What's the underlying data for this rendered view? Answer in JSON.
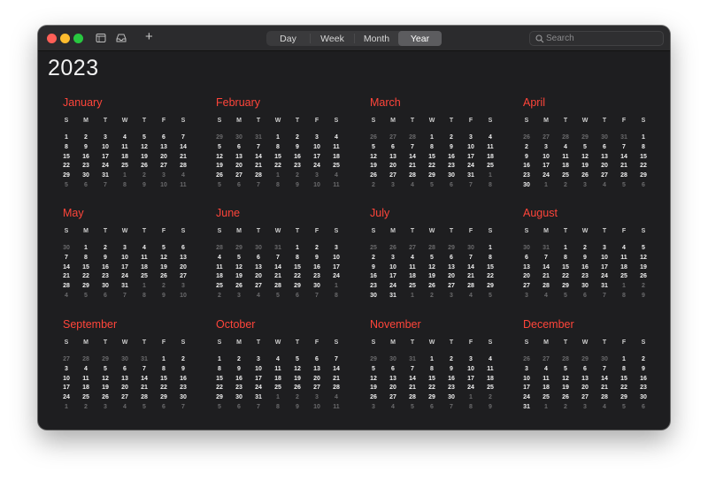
{
  "toolbar": {
    "add_label": "+",
    "views": [
      {
        "label": "Day",
        "active": false
      },
      {
        "label": "Week",
        "active": false
      },
      {
        "label": "Month",
        "active": false
      },
      {
        "label": "Year",
        "active": true
      }
    ],
    "search_placeholder": "Search"
  },
  "year": "2023",
  "weekday_labels": [
    "S",
    "M",
    "T",
    "W",
    "T",
    "F",
    "S"
  ],
  "colors": {
    "accent": "#ff453a",
    "background": "#1e1e20"
  },
  "months": [
    {
      "name": "January",
      "weeks": [
        [
          1,
          2,
          3,
          4,
          5,
          6,
          7
        ],
        [
          8,
          9,
          10,
          11,
          12,
          13,
          14
        ],
        [
          15,
          16,
          17,
          18,
          19,
          20,
          21
        ],
        [
          22,
          23,
          24,
          25,
          26,
          27,
          28
        ],
        [
          29,
          30,
          31,
          1,
          2,
          3,
          4
        ],
        [
          5,
          6,
          7,
          8,
          9,
          10,
          11
        ]
      ],
      "lead": 0,
      "days": 31
    },
    {
      "name": "February",
      "weeks": [
        [
          29,
          30,
          31,
          1,
          2,
          3,
          4
        ],
        [
          5,
          6,
          7,
          8,
          9,
          10,
          11
        ],
        [
          12,
          13,
          14,
          15,
          16,
          17,
          18
        ],
        [
          19,
          20,
          21,
          22,
          23,
          24,
          25
        ],
        [
          26,
          27,
          28,
          1,
          2,
          3,
          4
        ],
        [
          5,
          6,
          7,
          8,
          9,
          10,
          11
        ]
      ],
      "lead": 3,
      "days": 28
    },
    {
      "name": "March",
      "weeks": [
        [
          26,
          27,
          28,
          1,
          2,
          3,
          4
        ],
        [
          5,
          6,
          7,
          8,
          9,
          10,
          11
        ],
        [
          12,
          13,
          14,
          15,
          16,
          17,
          18
        ],
        [
          19,
          20,
          21,
          22,
          23,
          24,
          25
        ],
        [
          26,
          27,
          28,
          29,
          30,
          31,
          1
        ],
        [
          2,
          3,
          4,
          5,
          6,
          7,
          8
        ]
      ],
      "lead": 3,
      "days": 31
    },
    {
      "name": "April",
      "weeks": [
        [
          26,
          27,
          28,
          29,
          30,
          31,
          1
        ],
        [
          2,
          3,
          4,
          5,
          6,
          7,
          8
        ],
        [
          9,
          10,
          11,
          12,
          13,
          14,
          15
        ],
        [
          16,
          17,
          18,
          19,
          20,
          21,
          22
        ],
        [
          23,
          24,
          25,
          26,
          27,
          28,
          29
        ],
        [
          30,
          1,
          2,
          3,
          4,
          5,
          6
        ]
      ],
      "lead": 6,
      "days": 30
    },
    {
      "name": "May",
      "weeks": [
        [
          30,
          1,
          2,
          3,
          4,
          5,
          6
        ],
        [
          7,
          8,
          9,
          10,
          11,
          12,
          13
        ],
        [
          14,
          15,
          16,
          17,
          18,
          19,
          20
        ],
        [
          21,
          22,
          23,
          24,
          25,
          26,
          27
        ],
        [
          28,
          29,
          30,
          31,
          1,
          2,
          3
        ],
        [
          4,
          5,
          6,
          7,
          8,
          9,
          10
        ]
      ],
      "lead": 1,
      "days": 31
    },
    {
      "name": "June",
      "weeks": [
        [
          28,
          29,
          30,
          31,
          1,
          2,
          3
        ],
        [
          4,
          5,
          6,
          7,
          8,
          9,
          10
        ],
        [
          11,
          12,
          13,
          14,
          15,
          16,
          17
        ],
        [
          18,
          19,
          20,
          21,
          22,
          23,
          24
        ],
        [
          25,
          26,
          27,
          28,
          29,
          30,
          1
        ],
        [
          2,
          3,
          4,
          5,
          6,
          7,
          8
        ]
      ],
      "lead": 4,
      "days": 30
    },
    {
      "name": "July",
      "weeks": [
        [
          25,
          26,
          27,
          28,
          29,
          30,
          1
        ],
        [
          2,
          3,
          4,
          5,
          6,
          7,
          8
        ],
        [
          9,
          10,
          11,
          12,
          13,
          14,
          15
        ],
        [
          16,
          17,
          18,
          19,
          20,
          21,
          22
        ],
        [
          23,
          24,
          25,
          26,
          27,
          28,
          29
        ],
        [
          30,
          31,
          1,
          2,
          3,
          4,
          5
        ]
      ],
      "lead": 6,
      "days": 31
    },
    {
      "name": "August",
      "weeks": [
        [
          30,
          31,
          1,
          2,
          3,
          4,
          5
        ],
        [
          6,
          7,
          8,
          9,
          10,
          11,
          12
        ],
        [
          13,
          14,
          15,
          16,
          17,
          18,
          19
        ],
        [
          20,
          21,
          22,
          23,
          24,
          25,
          26
        ],
        [
          27,
          28,
          29,
          30,
          31,
          1,
          2
        ],
        [
          3,
          4,
          5,
          6,
          7,
          8,
          9
        ]
      ],
      "lead": 2,
      "days": 31
    },
    {
      "name": "September",
      "weeks": [
        [
          27,
          28,
          29,
          30,
          31,
          1,
          2
        ],
        [
          3,
          4,
          5,
          6,
          7,
          8,
          9
        ],
        [
          10,
          11,
          12,
          13,
          14,
          15,
          16
        ],
        [
          17,
          18,
          19,
          20,
          21,
          22,
          23
        ],
        [
          24,
          25,
          26,
          27,
          28,
          29,
          30
        ],
        [
          1,
          2,
          3,
          4,
          5,
          6,
          7
        ]
      ],
      "lead": 5,
      "days": 30
    },
    {
      "name": "October",
      "weeks": [
        [
          1,
          2,
          3,
          4,
          5,
          6,
          7
        ],
        [
          8,
          9,
          10,
          11,
          12,
          13,
          14
        ],
        [
          15,
          16,
          17,
          18,
          19,
          20,
          21
        ],
        [
          22,
          23,
          24,
          25,
          26,
          27,
          28
        ],
        [
          29,
          30,
          31,
          1,
          2,
          3,
          4
        ],
        [
          5,
          6,
          7,
          8,
          9,
          10,
          11
        ]
      ],
      "lead": 0,
      "days": 31
    },
    {
      "name": "November",
      "weeks": [
        [
          29,
          30,
          31,
          1,
          2,
          3,
          4
        ],
        [
          5,
          6,
          7,
          8,
          9,
          10,
          11
        ],
        [
          12,
          13,
          14,
          15,
          16,
          17,
          18
        ],
        [
          19,
          20,
          21,
          22,
          23,
          24,
          25
        ],
        [
          26,
          27,
          28,
          29,
          30,
          1,
          2
        ],
        [
          3,
          4,
          5,
          6,
          7,
          8,
          9
        ]
      ],
      "lead": 3,
      "days": 30
    },
    {
      "name": "December",
      "weeks": [
        [
          26,
          27,
          28,
          29,
          30,
          1,
          2
        ],
        [
          3,
          4,
          5,
          6,
          7,
          8,
          9
        ],
        [
          10,
          11,
          12,
          13,
          14,
          15,
          16
        ],
        [
          17,
          18,
          19,
          20,
          21,
          22,
          23
        ],
        [
          24,
          25,
          26,
          27,
          28,
          29,
          30
        ],
        [
          31,
          1,
          2,
          3,
          4,
          5,
          6
        ]
      ],
      "lead": 5,
      "days": 31
    }
  ]
}
